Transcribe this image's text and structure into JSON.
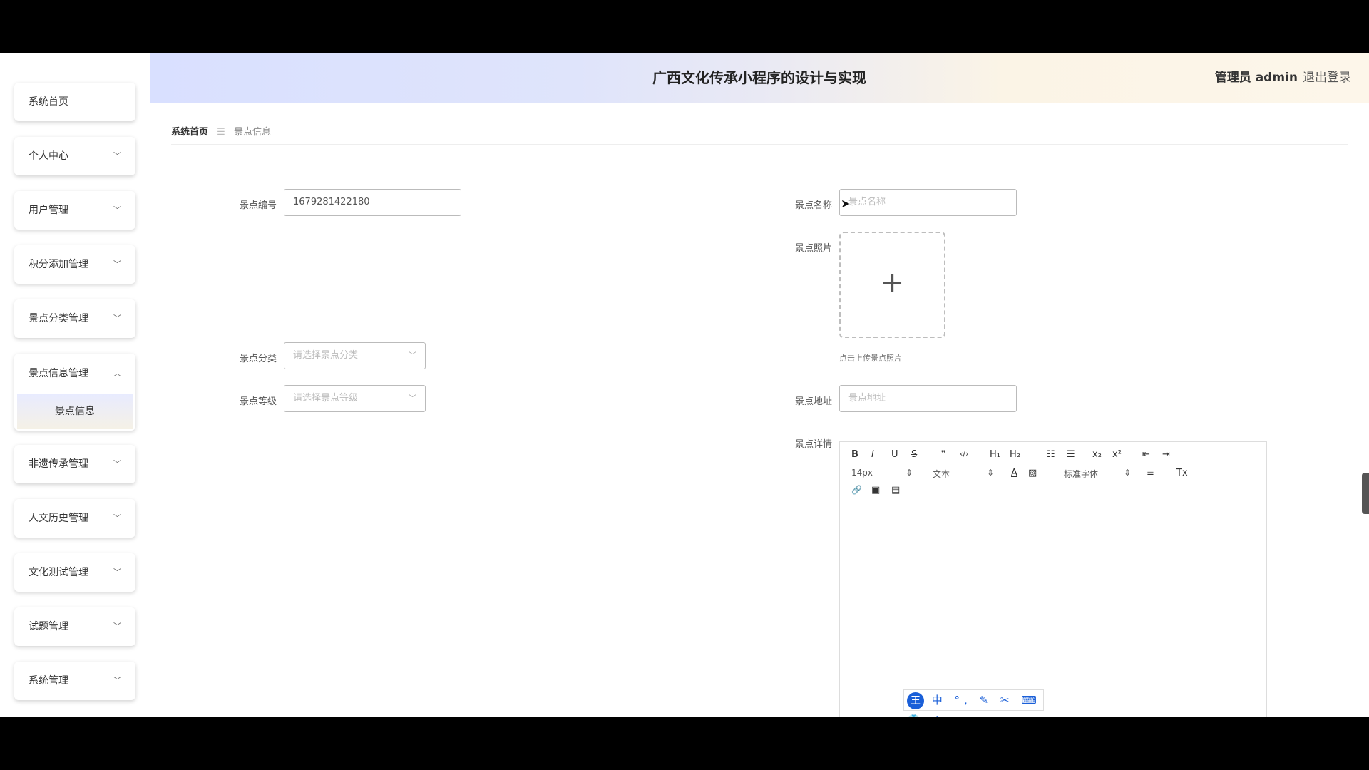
{
  "header": {
    "title": "广西文化传承小程序的设计与实现",
    "user": "管理员 admin",
    "logout": "退出登录"
  },
  "sidebar": {
    "items": [
      {
        "label": "系统首页",
        "chevron": ""
      },
      {
        "label": "个人中心",
        "chevron": "﹀"
      },
      {
        "label": "用户管理",
        "chevron": "﹀"
      },
      {
        "label": "积分添加管理",
        "chevron": "﹀"
      },
      {
        "label": "景点分类管理",
        "chevron": "﹀"
      },
      {
        "label": "景点信息管理",
        "chevron": "︿",
        "sub": "景点信息"
      },
      {
        "label": "非遗传承管理",
        "chevron": "﹀"
      },
      {
        "label": "人文历史管理",
        "chevron": "﹀"
      },
      {
        "label": "文化测试管理",
        "chevron": "﹀"
      },
      {
        "label": "试题管理",
        "chevron": "﹀"
      },
      {
        "label": "系统管理",
        "chevron": "﹀"
      }
    ]
  },
  "breadcrumb": {
    "home": "系统首页",
    "sep": "☰",
    "current": "景点信息"
  },
  "form": {
    "code_label": "景点编号",
    "code_value": "1679281422180",
    "name_label": "景点名称",
    "name_placeholder": "景点名称",
    "photo_label": "景点照片",
    "photo_plus": "+",
    "photo_hint": "点击上传景点照片",
    "category_label": "景点分类",
    "category_placeholder": "请选择景点分类",
    "level_label": "景点等级",
    "level_placeholder": "请选择景点等级",
    "address_label": "景点地址",
    "address_placeholder": "景点地址",
    "detail_label": "景点详情"
  },
  "editor": {
    "row1": [
      "B",
      "I",
      "U",
      "S",
      "❞",
      "‹/›",
      "H₁",
      "H₂",
      "☷",
      "☰",
      "x₂",
      "x²",
      "⇤",
      "⇥"
    ],
    "font_size": "14px",
    "heading": "文本",
    "font_family": "标准字体",
    "select_arrow": "⇕",
    "row2_icons": [
      "A",
      "▧",
      "≡",
      "Tx"
    ],
    "row3": [
      "🔗",
      "▣",
      "▤"
    ]
  },
  "ime": {
    "logo": "王",
    "items": "中 °, ✎ ✂ ⌨ 👕 ⚙"
  }
}
